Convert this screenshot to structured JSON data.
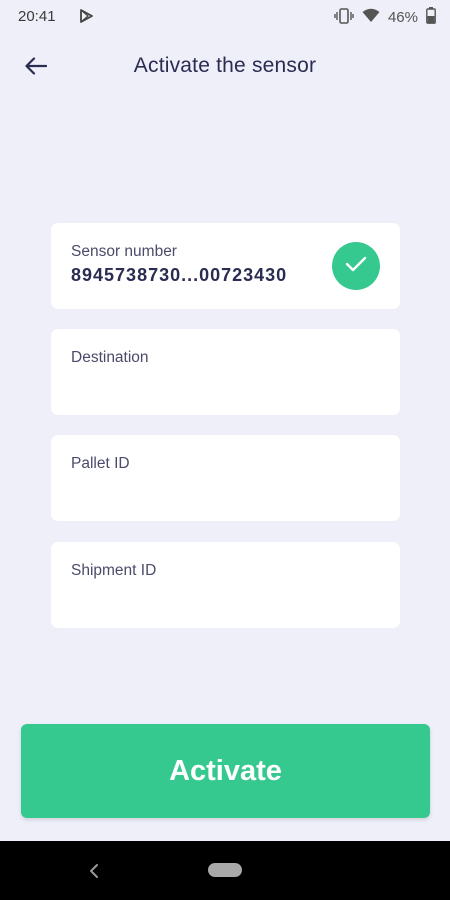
{
  "status_bar": {
    "time": "20:41",
    "battery": "46%",
    "icons": [
      "play-store-icon",
      "vibrate-icon",
      "wifi-icon",
      "battery-icon"
    ]
  },
  "header": {
    "title": "Activate the sensor",
    "back_icon": "arrow-left-icon"
  },
  "form": {
    "sensor_number": {
      "label": "Sensor number",
      "value": "8945738730...00723430",
      "verified_icon": "check-icon"
    },
    "destination": {
      "label": "Destination",
      "value": ""
    },
    "pallet_id": {
      "label": "Pallet ID",
      "value": ""
    },
    "shipment_id": {
      "label": "Shipment ID",
      "value": ""
    }
  },
  "actions": {
    "activate_label": "Activate"
  },
  "colors": {
    "background": "#eeeff9",
    "accent": "#36c98f",
    "text": "#2b2c52",
    "card": "#ffffff"
  }
}
